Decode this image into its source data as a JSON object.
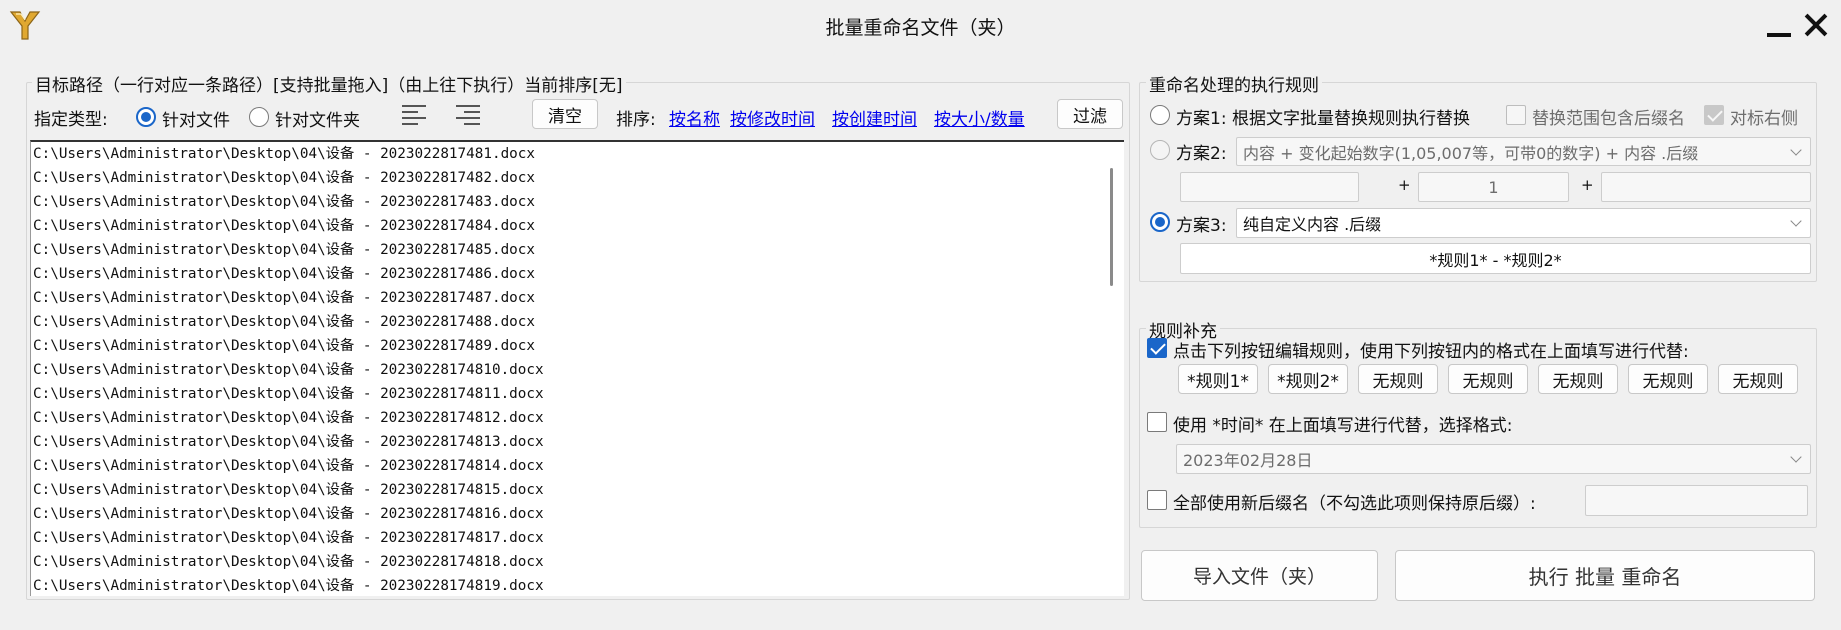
{
  "window": {
    "title": "批量重命名文件（夹）",
    "icon": "y-logo-icon"
  },
  "left": {
    "group_label": "目标路径（一行对应一条路径）[支持批量拖入]（由上往下执行）当前排序[无]",
    "type_label": "指定类型:",
    "type_options": [
      "针对文件",
      "针对文件夹"
    ],
    "type_selected": "针对文件",
    "clear_label": "清空",
    "sort_label": "排序:",
    "sort_links": [
      "按名称",
      "按修改时间",
      "按创建时间",
      "按大小/数量"
    ],
    "filter_label": "过滤",
    "paths": [
      "C:\\Users\\Administrator\\Desktop\\04\\设备 - 2023022817481.docx",
      "C:\\Users\\Administrator\\Desktop\\04\\设备 - 2023022817482.docx",
      "C:\\Users\\Administrator\\Desktop\\04\\设备 - 2023022817483.docx",
      "C:\\Users\\Administrator\\Desktop\\04\\设备 - 2023022817484.docx",
      "C:\\Users\\Administrator\\Desktop\\04\\设备 - 2023022817485.docx",
      "C:\\Users\\Administrator\\Desktop\\04\\设备 - 2023022817486.docx",
      "C:\\Users\\Administrator\\Desktop\\04\\设备 - 2023022817487.docx",
      "C:\\Users\\Administrator\\Desktop\\04\\设备 - 2023022817488.docx",
      "C:\\Users\\Administrator\\Desktop\\04\\设备 - 2023022817489.docx",
      "C:\\Users\\Administrator\\Desktop\\04\\设备 - 20230228174810.docx",
      "C:\\Users\\Administrator\\Desktop\\04\\设备 - 20230228174811.docx",
      "C:\\Users\\Administrator\\Desktop\\04\\设备 - 20230228174812.docx",
      "C:\\Users\\Administrator\\Desktop\\04\\设备 - 20230228174813.docx",
      "C:\\Users\\Administrator\\Desktop\\04\\设备 - 20230228174814.docx",
      "C:\\Users\\Administrator\\Desktop\\04\\设备 - 20230228174815.docx",
      "C:\\Users\\Administrator\\Desktop\\04\\设备 - 20230228174816.docx",
      "C:\\Users\\Administrator\\Desktop\\04\\设备 - 20230228174817.docx",
      "C:\\Users\\Administrator\\Desktop\\04\\设备 - 20230228174818.docx",
      "C:\\Users\\Administrator\\Desktop\\04\\设备 - 20230228174819.docx"
    ]
  },
  "rules": {
    "group_label": "重命名处理的执行规则",
    "plan1": {
      "label": "方案1: 根据文字批量替换规则执行替换",
      "include_ext_label": "替换范围包含后缀名",
      "align_right_label": "对标右侧"
    },
    "plan2": {
      "label": "方案2:",
      "select_value": "内容 + 变化起始数字(1,05,007等，可带0的数字) + 内容 .后缀",
      "plus1": "+",
      "plus2": "+",
      "start_number": "1"
    },
    "plan3": {
      "label": "方案3:",
      "select_value": "纯自定义内容 .后缀",
      "pattern": "*规则1* - *规则2*"
    },
    "selected_plan": "方案3"
  },
  "supplement": {
    "group_label": "规则补充",
    "edit_rule_label": "点击下列按钮编辑规则，使用下列按钮内的格式在上面填写进行代替:",
    "rule_buttons": [
      "*规则1*",
      "*规则2*",
      "无规则",
      "无规则",
      "无规则",
      "无规则",
      "无规则"
    ],
    "use_time_label": "使用 *时间* 在上面填写进行代替，选择格式:",
    "time_format_value": "2023年02月28日",
    "new_ext_label": "全部使用新后缀名（不勾选此项则保持原后缀）:"
  },
  "actions": {
    "import_label": "导入文件（夹）",
    "execute_label": "执行 批量 重命名"
  },
  "colors": {
    "accent": "#1a66c9",
    "link": "#0000ee",
    "background": "#f0f0f0"
  }
}
